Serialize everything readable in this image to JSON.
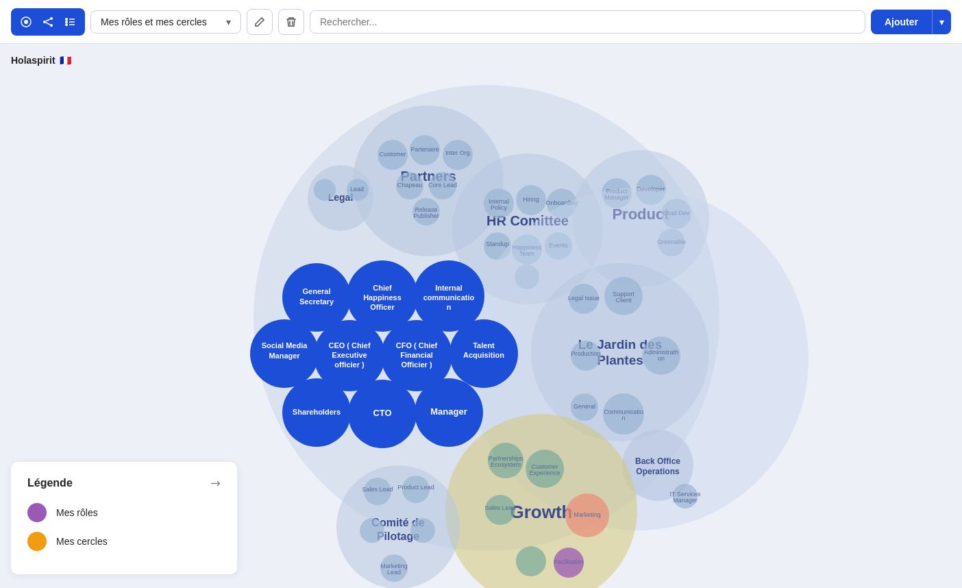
{
  "header": {
    "icon1": "⊙",
    "icon2": "⋮⋮",
    "icon3": "⋯",
    "dropdown_label": "Mes rôles et mes cercles",
    "edit_icon": "✎",
    "delete_icon": "🗑",
    "search_placeholder": "Rechercher...",
    "add_label": "Ajouter"
  },
  "org": {
    "title": "Holaspirit",
    "flag": "🇫🇷"
  },
  "legend": {
    "title": "Légende",
    "collapse_icon": "↗",
    "items": [
      {
        "label": "Mes rôles",
        "color": "#9b59b6"
      },
      {
        "label": "Mes cercles",
        "color": "#f39c12"
      }
    ]
  },
  "circles": {
    "main_bg": "#cdd5ee",
    "blue_dark": "#1d4ed8",
    "blue_med": "#93afd8",
    "blue_light": "#c5d3eb",
    "teal": "#5c8a8a",
    "gold": "#e8c97e",
    "pink": "#d4748a"
  }
}
